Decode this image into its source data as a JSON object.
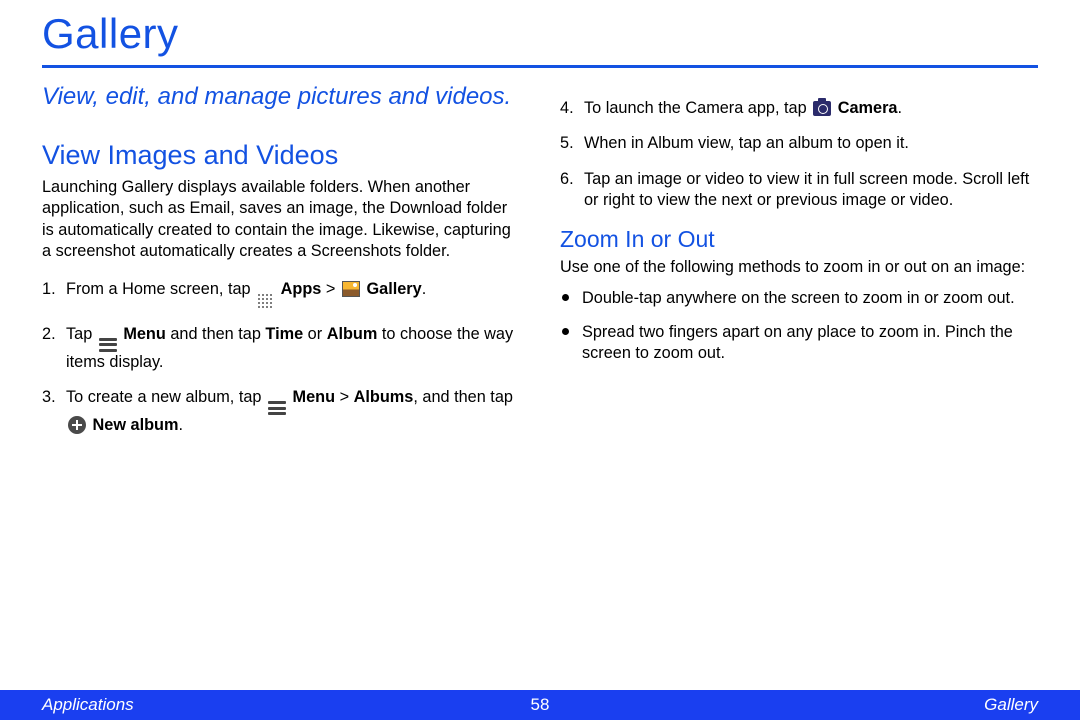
{
  "title": "Gallery",
  "subtitle": "View, edit, and manage pictures and videos.",
  "section1": {
    "heading": "View Images and Videos",
    "intro": "Launching Gallery displays available folders. When another application, such as Email, saves an image, the Download folder is automatically created to contain the image. Likewise, capturing a screenshot automatically creates a Screenshots folder.",
    "step1_a": "From a Home screen, tap ",
    "step1_apps": "Apps",
    "step1_sep": " > ",
    "step1_gallery": "Gallery",
    "step1_end": ".",
    "step2_a": "Tap ",
    "step2_menu": "Menu",
    "step2_b": " and then tap ",
    "step2_time": "Time",
    "step2_or": " or ",
    "step2_album": "Album",
    "step2_c": " to choose the way items display.",
    "step3_a": "To create a new album, tap ",
    "step3_menu": "Menu",
    "step3_sep": " > ",
    "step3_albums": "Albums",
    "step3_b": ", and then tap ",
    "step3_newalbum": "New album",
    "step3_end": ".",
    "step4_a": "To launch the Camera app, tap ",
    "step4_camera": "Camera",
    "step4_end": ".",
    "step5": "When in Album view, tap an album to open it.",
    "step6": "Tap an image or video to view it in full screen mode. Scroll left or right to view the next or previous image or video."
  },
  "section2": {
    "heading": "Zoom In or Out",
    "intro": "Use one of the following methods to zoom in or out on an image:",
    "b1": "Double-tap anywhere on the screen to zoom in or zoom out.",
    "b2": "Spread two fingers apart on any place to zoom in. Pinch the screen to zoom out."
  },
  "footer": {
    "left": "Applications",
    "page": "58",
    "right": "Gallery"
  }
}
